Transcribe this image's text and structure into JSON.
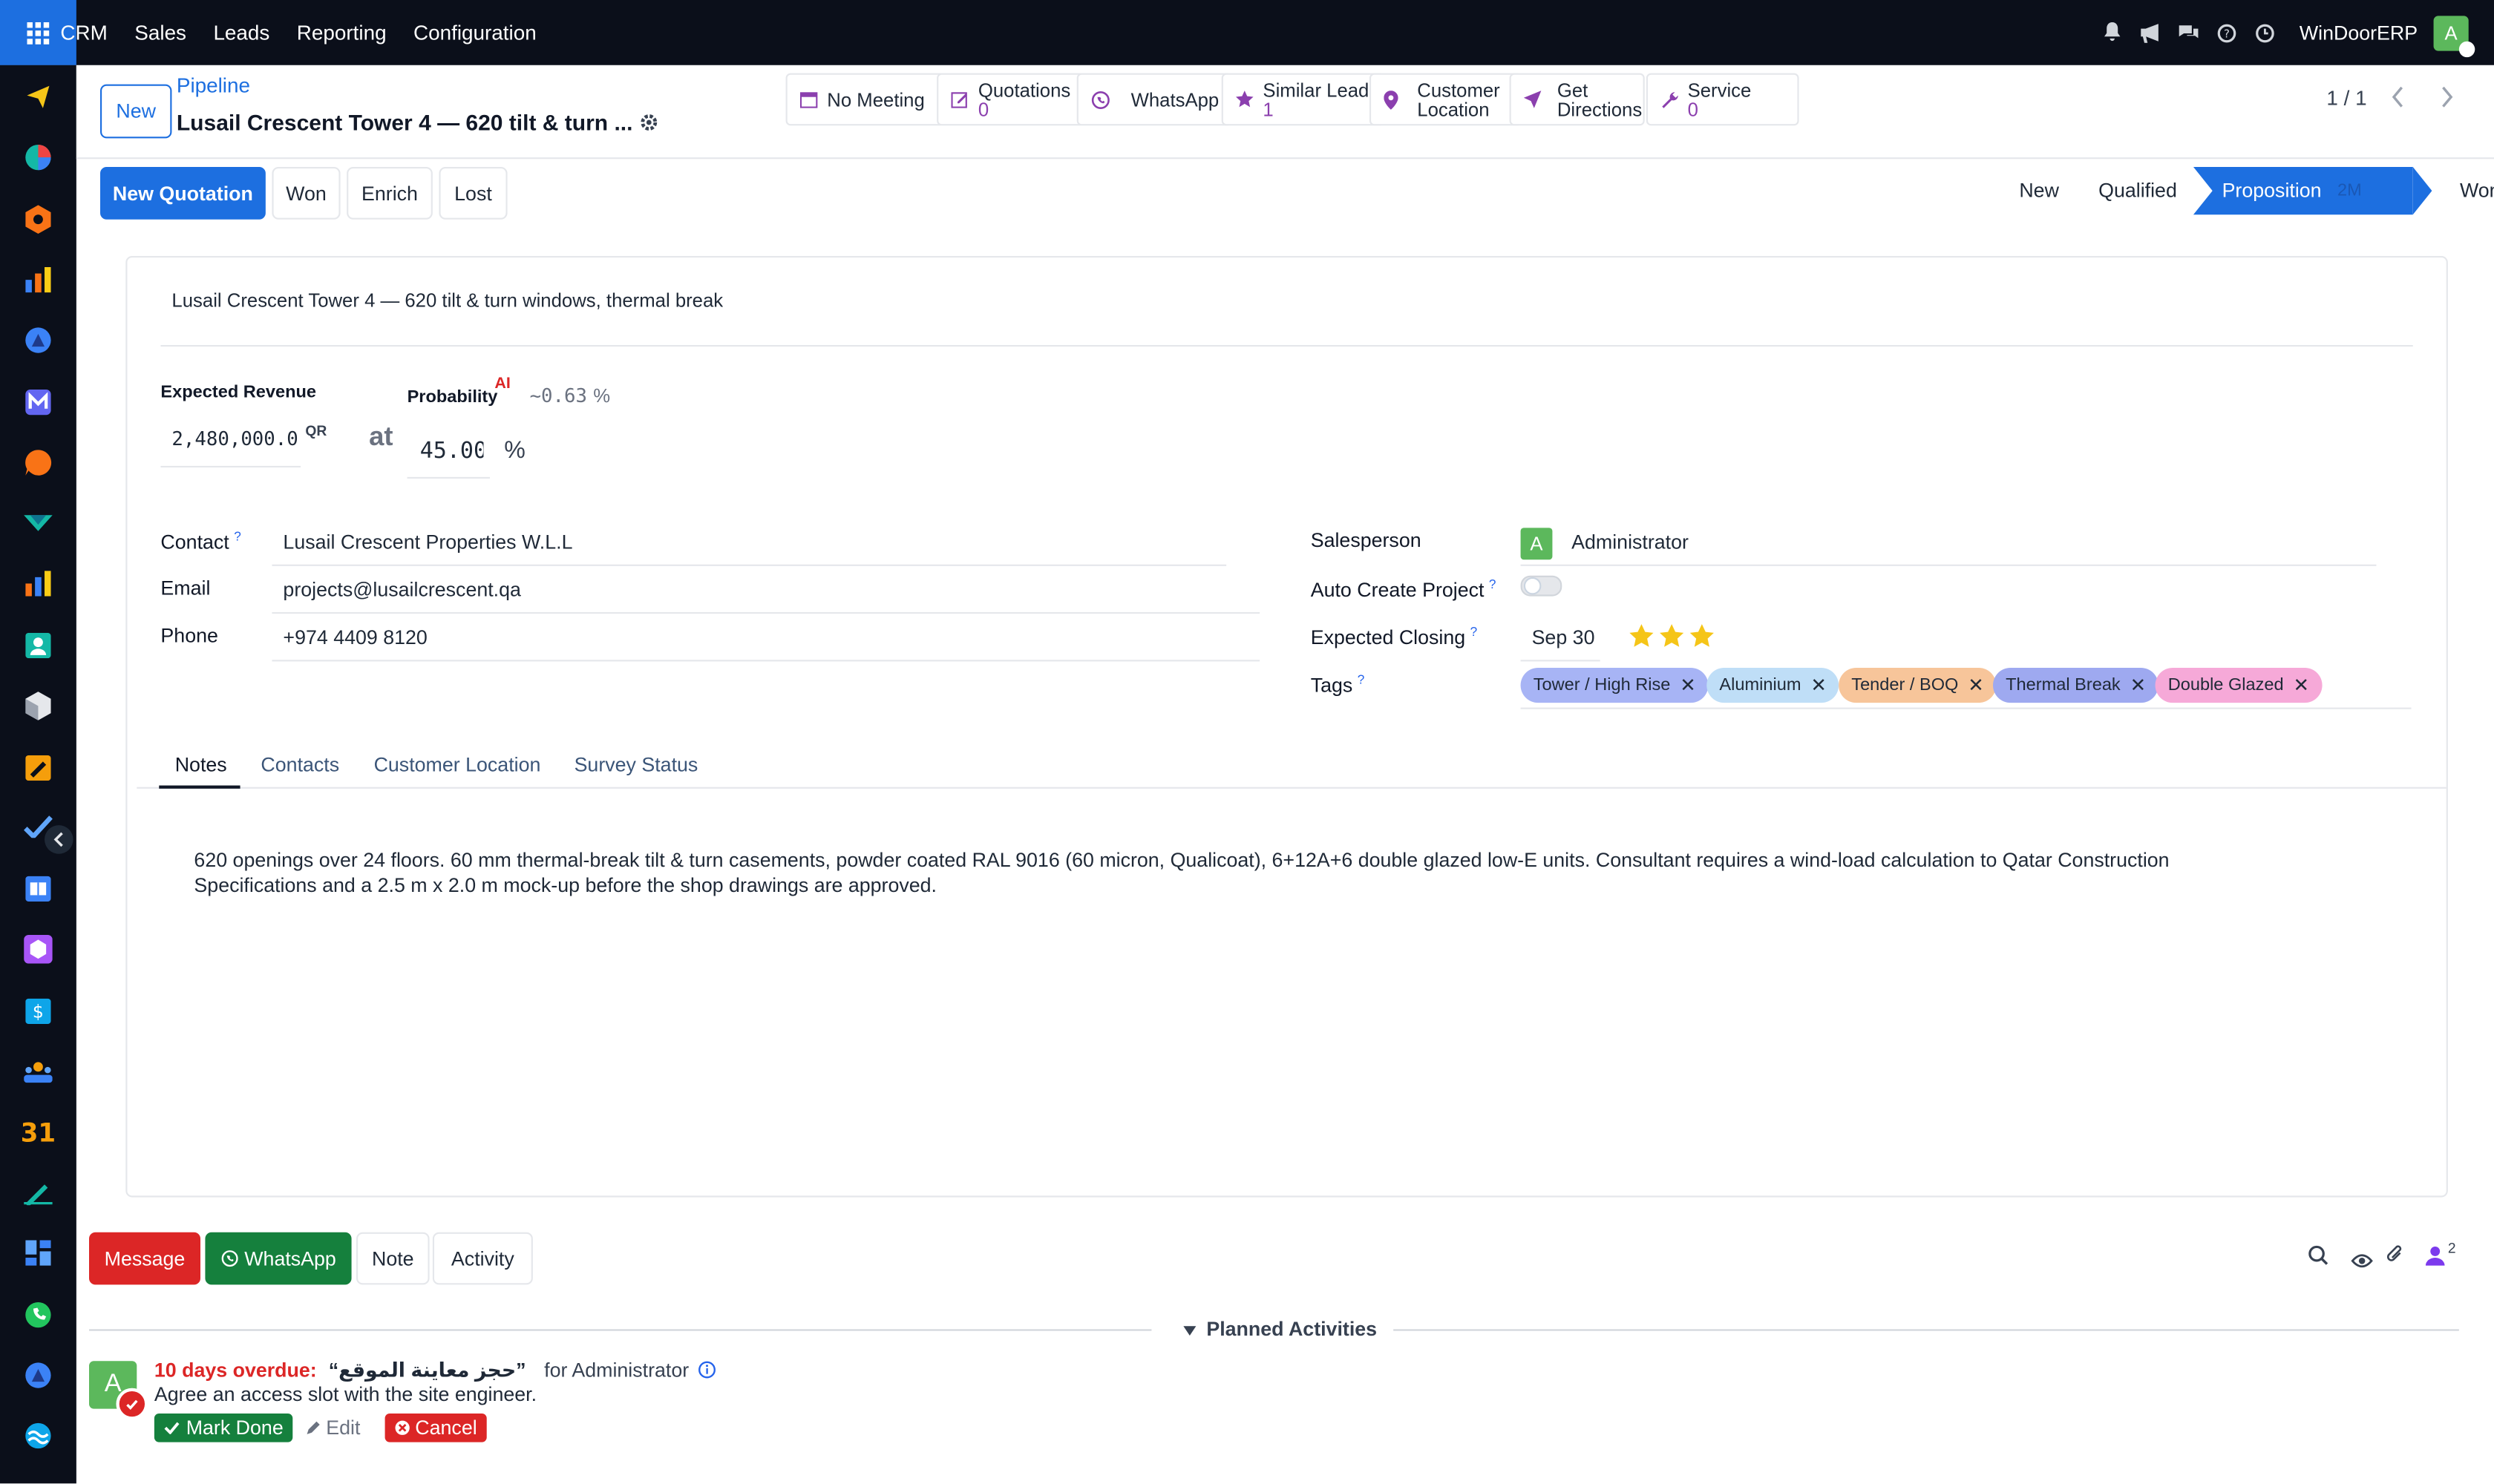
{
  "navbar": {
    "menu": [
      "CRM",
      "Sales",
      "Leads",
      "Reporting",
      "Configuration"
    ],
    "company": "WinDoorERP",
    "user_initial": "A"
  },
  "control": {
    "new_label": "New",
    "breadcrumb": "Pipeline",
    "title": "Lusail Crescent Tower 4 — 620 tilt & turn ...",
    "smart_buttons": {
      "meeting": {
        "label": "No Meeting"
      },
      "quotations": {
        "label": "Quotations",
        "count": "0"
      },
      "whatsapp": {
        "label": "WhatsApp"
      },
      "similar": {
        "label": "Similar Lead",
        "count": "1"
      },
      "customer_location": {
        "line1": "Customer",
        "line2": "Location"
      },
      "directions": {
        "line1": "Get",
        "line2": "Directions"
      },
      "service": {
        "label": "Service",
        "count": "0"
      }
    },
    "pager": "1 / 1"
  },
  "statusbar": {
    "buttons": {
      "new_quotation": "New Quotation",
      "won": "Won",
      "enrich": "Enrich",
      "lost": "Lost"
    },
    "stages": {
      "new": "New",
      "qualified": "Qualified",
      "proposition": "Proposition",
      "proposition_duration": "2M",
      "won": "Won"
    }
  },
  "form": {
    "lead_name": "Lusail Crescent Tower 4 — 620 tilt & turn windows, thermal break",
    "expected_revenue_label": "Expected Revenue",
    "expected_revenue": "2,480,000.0",
    "currency": "QR",
    "at": "at",
    "probability_label": "Probability",
    "ai_label": "AI",
    "ai_probability": "~0.63",
    "ai_pct": "%",
    "probability": "45.00",
    "pct": "%",
    "contact_label": "Contact",
    "contact": "Lusail Crescent Properties W.L.L",
    "email_label": "Email",
    "email": "projects@lusailcrescent.qa",
    "phone_label": "Phone",
    "phone": "+974 4409 8120",
    "salesperson_label": "Salesperson",
    "salesperson": "Administrator",
    "salesperson_initial": "A",
    "auto_project_label": "Auto Create Project",
    "closing_label": "Expected Closing",
    "closing": "Sep 30",
    "priority_stars": 3,
    "tags_label": "Tags",
    "help_mark": "?",
    "tags": [
      {
        "label": "Tower / High Rise",
        "color": "#a7b4f5"
      },
      {
        "label": "Aluminium",
        "color": "#bfdef7"
      },
      {
        "label": "Tender / BOQ",
        "color": "#f7c59a"
      },
      {
        "label": "Thermal Break",
        "color": "#9ea9f0"
      },
      {
        "label": "Double Glazed",
        "color": "#f6a9d8"
      }
    ],
    "tabs": [
      "Notes",
      "Contacts",
      "Customer Location",
      "Survey Status"
    ],
    "notes": "620 openings over 24 floors. 60 mm thermal-break tilt & turn casements, powder coated RAL 9016 (60 micron, Qualicoat), 6+12A+6 double glazed low-E units. Consultant requires a wind-load calculation to Qatar Construction Specifications and a 2.5 m x 2.0 m mock-up before the shop drawings are approved."
  },
  "chatter": {
    "buttons": {
      "message": "Message",
      "whatsapp": "WhatsApp",
      "note": "Note",
      "activity": "Activity"
    },
    "followers_count": "2",
    "planned_label": "Planned Activities",
    "activity": {
      "overdue": "10 days overdue:",
      "summary": "“حجز معاينة الموقع”",
      "for_text": "for Administrator",
      "note": "Agree an access slot with the site engineer.",
      "avatar_initial": "A",
      "mark_done": "Mark Done",
      "edit": "Edit",
      "cancel": "Cancel"
    }
  }
}
